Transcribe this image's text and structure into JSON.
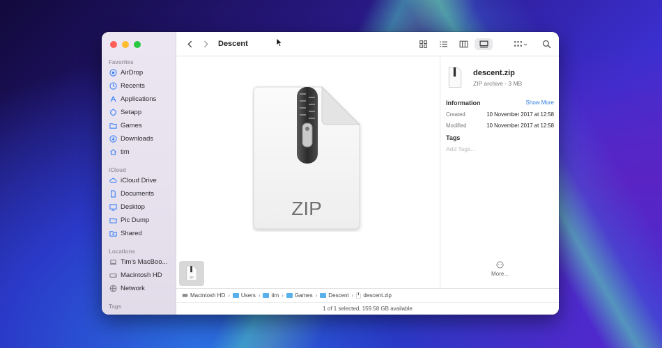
{
  "window": {
    "title": "Descent",
    "sidebar": {
      "sections": [
        {
          "heading": "Favorites",
          "items": [
            {
              "label": "AirDrop",
              "icon": "airdrop-icon"
            },
            {
              "label": "Recents",
              "icon": "clock-icon"
            },
            {
              "label": "Applications",
              "icon": "applications-icon"
            },
            {
              "label": "Setapp",
              "icon": "setapp-icon"
            },
            {
              "label": "Games",
              "icon": "folder-icon"
            },
            {
              "label": "Downloads",
              "icon": "download-icon"
            },
            {
              "label": "tim",
              "icon": "home-icon"
            }
          ]
        },
        {
          "heading": "iCloud",
          "items": [
            {
              "label": "iCloud Drive",
              "icon": "cloud-icon"
            },
            {
              "label": "Documents",
              "icon": "document-icon"
            },
            {
              "label": "Desktop",
              "icon": "desktop-icon"
            },
            {
              "label": "Pic Dump",
              "icon": "folder-icon"
            },
            {
              "label": "Shared",
              "icon": "shared-folder-icon"
            }
          ]
        },
        {
          "heading": "Locations",
          "items": [
            {
              "label": "Tim's MacBoo...",
              "icon": "laptop-icon"
            },
            {
              "label": "Macintosh HD",
              "icon": "disk-icon"
            },
            {
              "label": "Network",
              "icon": "globe-icon"
            }
          ]
        },
        {
          "heading": "Tags",
          "items": []
        }
      ]
    },
    "preview": {
      "file_type_label": "ZIP"
    },
    "inspector": {
      "file_name": "descent.zip",
      "file_kind": "ZIP archive - 3 MB",
      "information_heading": "Information",
      "show_more": "Show More",
      "rows": [
        {
          "key": "Created",
          "value": "10 November 2017 at 12:58"
        },
        {
          "key": "Modified",
          "value": "10 November 2017 at 12:58"
        }
      ],
      "tags_heading": "Tags",
      "tags_placeholder": "Add Tags...",
      "more_label": "More..."
    },
    "pathbar": [
      "Macintosh HD",
      "Users",
      "tim",
      "Games",
      "Descent",
      "descent.zip"
    ],
    "status": "1 of 1 selected, 159.58 GB available",
    "thumbnail_label": "ZIP"
  }
}
